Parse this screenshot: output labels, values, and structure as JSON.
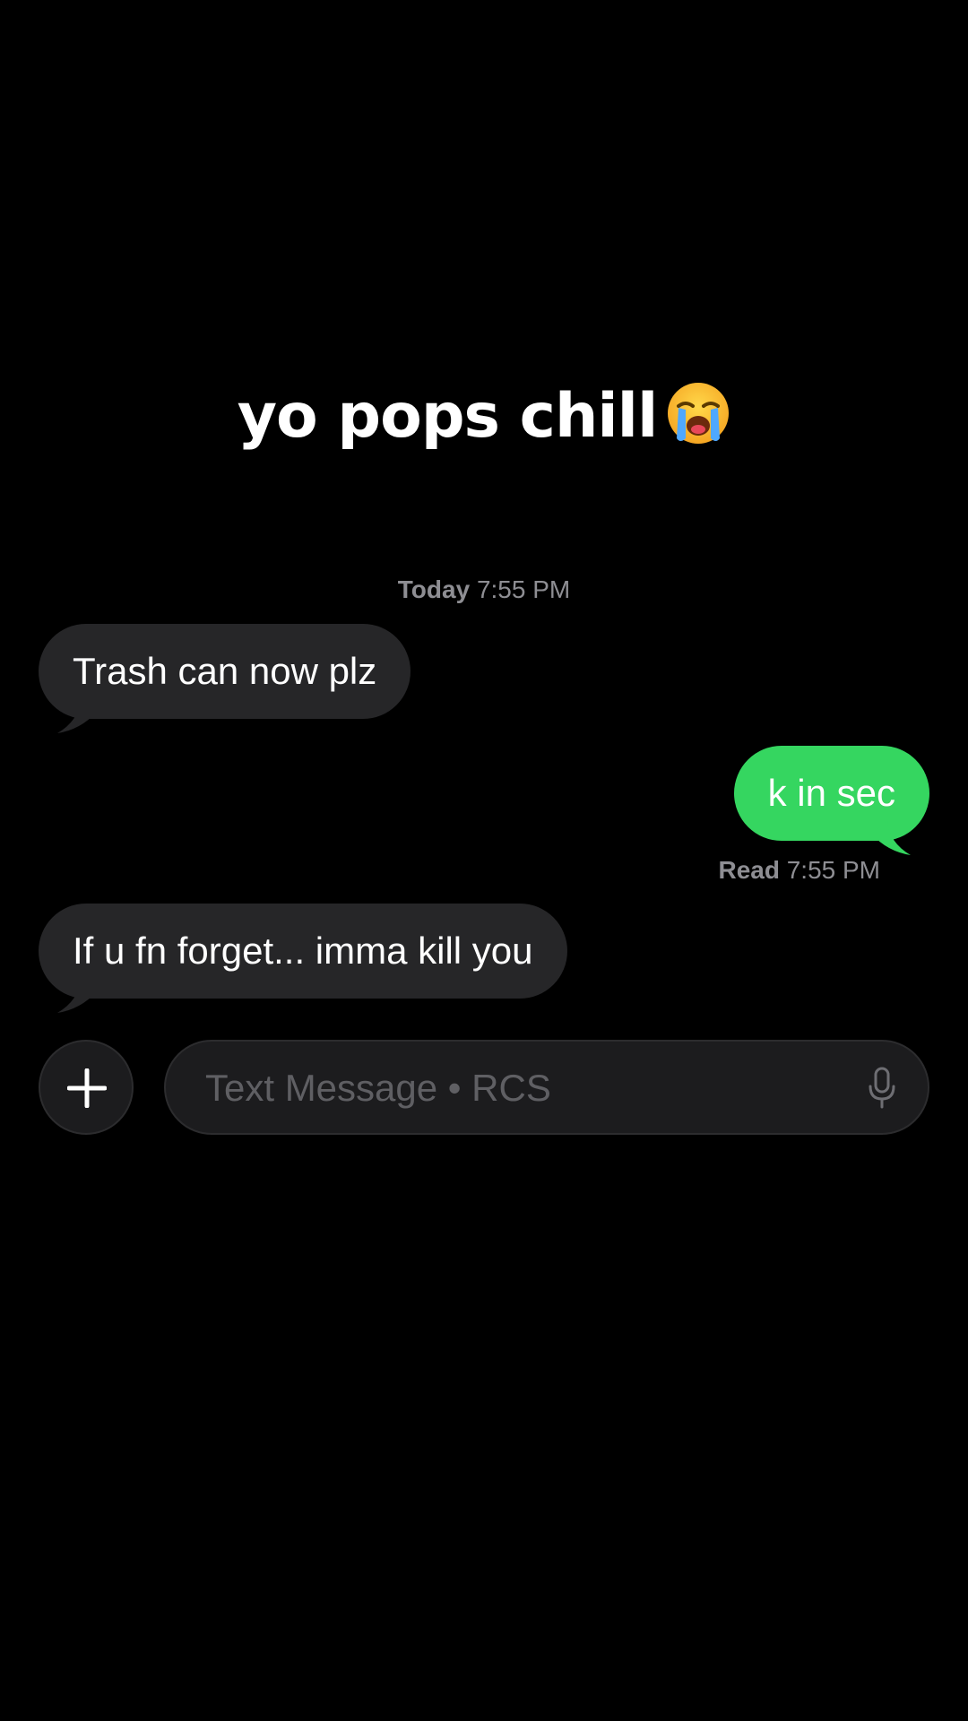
{
  "caption": {
    "text": "yo pops chill",
    "emoji_icon": "loudly-crying-face-icon"
  },
  "thread": {
    "date_label": "Today",
    "date_time": "7:55 PM",
    "messages": [
      {
        "direction": "incoming",
        "text": "Trash can now plz"
      },
      {
        "direction": "outgoing",
        "text": "k in sec"
      },
      {
        "direction": "incoming",
        "text": "If u fn forget... imma kill you"
      }
    ],
    "read_label": "Read",
    "read_time": "7:55 PM"
  },
  "composer": {
    "add_icon": "plus-icon",
    "placeholder": "Text Message • RCS",
    "value": "",
    "mic_icon": "microphone-icon"
  },
  "colors": {
    "background": "#000000",
    "incoming_bubble": "#262628",
    "outgoing_bubble": "#35d660",
    "secondary_text": "#8e8e93"
  }
}
